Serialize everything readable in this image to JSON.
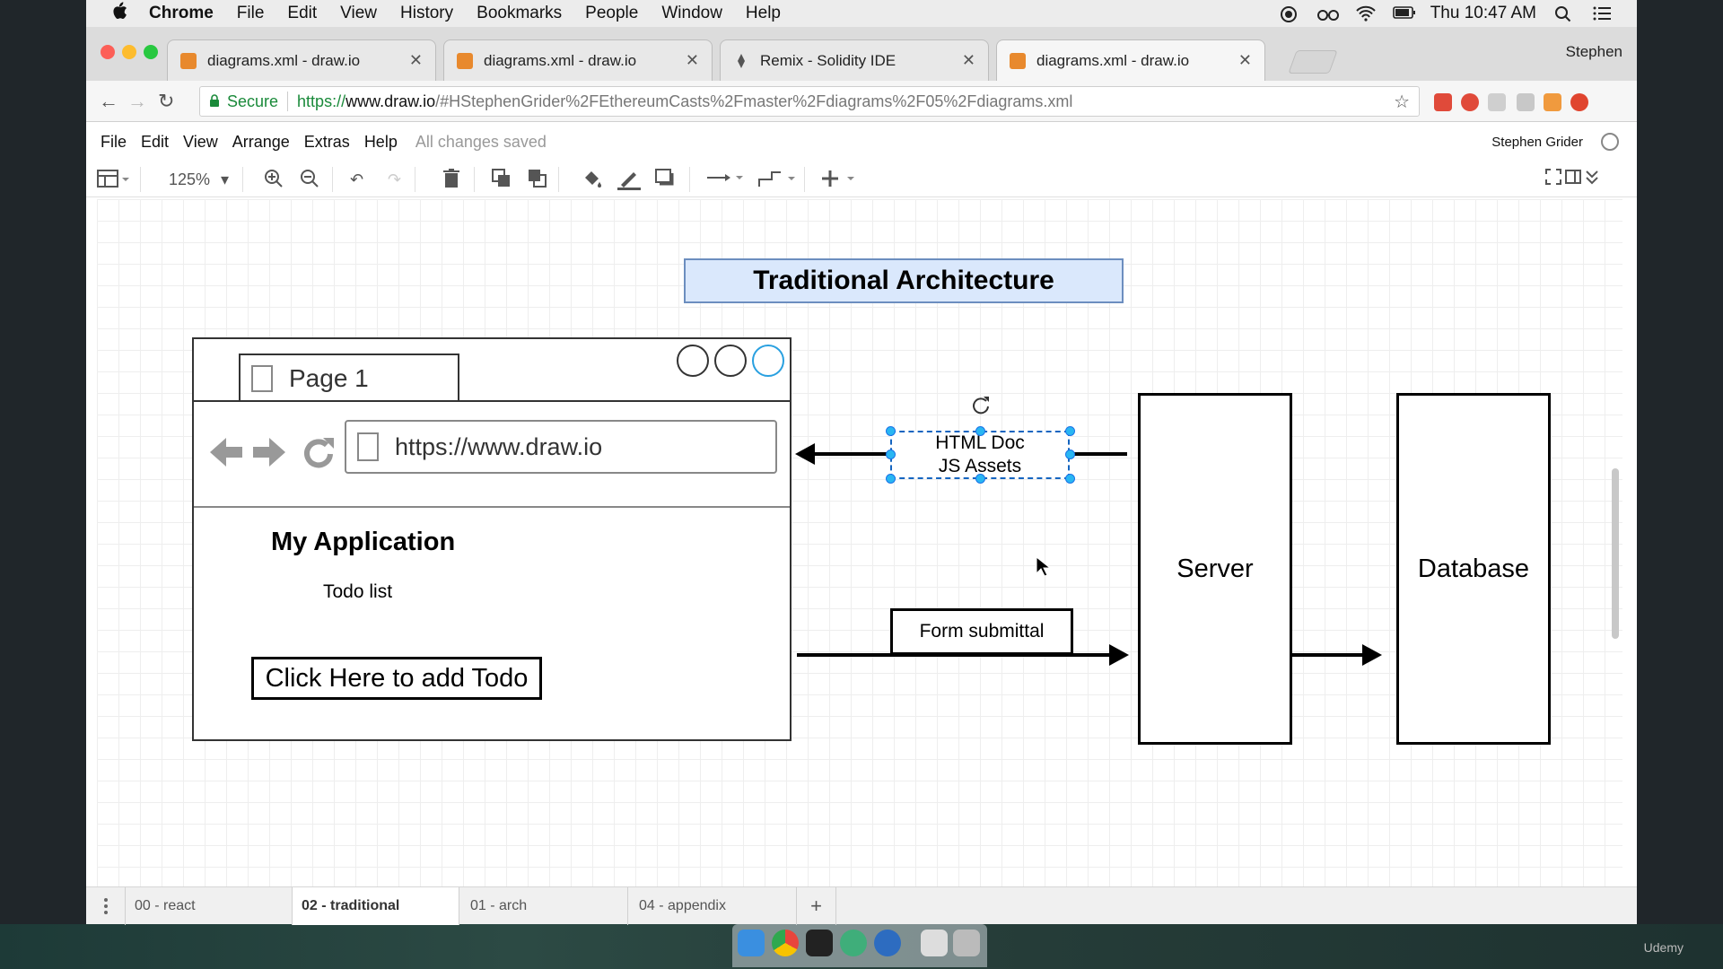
{
  "menubar": {
    "apple": "",
    "app": "Chrome",
    "items": [
      "File",
      "Edit",
      "View",
      "History",
      "Bookmarks",
      "People",
      "Window",
      "Help"
    ],
    "clock": "Thu 10:47 AM"
  },
  "tabs": [
    {
      "title": "diagrams.xml - draw.io"
    },
    {
      "title": "diagrams.xml - draw.io"
    },
    {
      "title": "Remix - Solidity IDE"
    },
    {
      "title": "diagrams.xml - draw.io"
    }
  ],
  "profile": "Stephen",
  "address": {
    "secure": "Secure",
    "scheme": "https://",
    "host": "www.draw.io",
    "path": "/#HStephenGrider%2FEthereumCasts%2Fmaster%2Fdiagrams%2F05%2Fdiagrams.xml"
  },
  "drawio_menu": {
    "items": [
      "File",
      "Edit",
      "View",
      "Arrange",
      "Extras",
      "Help"
    ],
    "status": "All changes saved",
    "user": "Stephen Grider"
  },
  "toolbar": {
    "zoom": "125%"
  },
  "diagram": {
    "title": "Traditional Architecture",
    "browser_tab": "Page 1",
    "browser_url": "https://www.draw.io",
    "app_title": "My Application",
    "todo_label": "Todo list",
    "add_button": "Click Here to add Todo",
    "response_line1": "HTML Doc",
    "response_line2": "JS Assets",
    "form_label": "Form submittal",
    "server": "Server",
    "database": "Database"
  },
  "page_tabs": [
    "00 - react",
    "02 - traditional",
    "01 - arch",
    "04 - appendix"
  ],
  "watermark": "Udemy",
  "colors": {
    "title_fill": "#dae8fc",
    "title_stroke": "#6c8ebf",
    "selection": "#29b6f2"
  }
}
